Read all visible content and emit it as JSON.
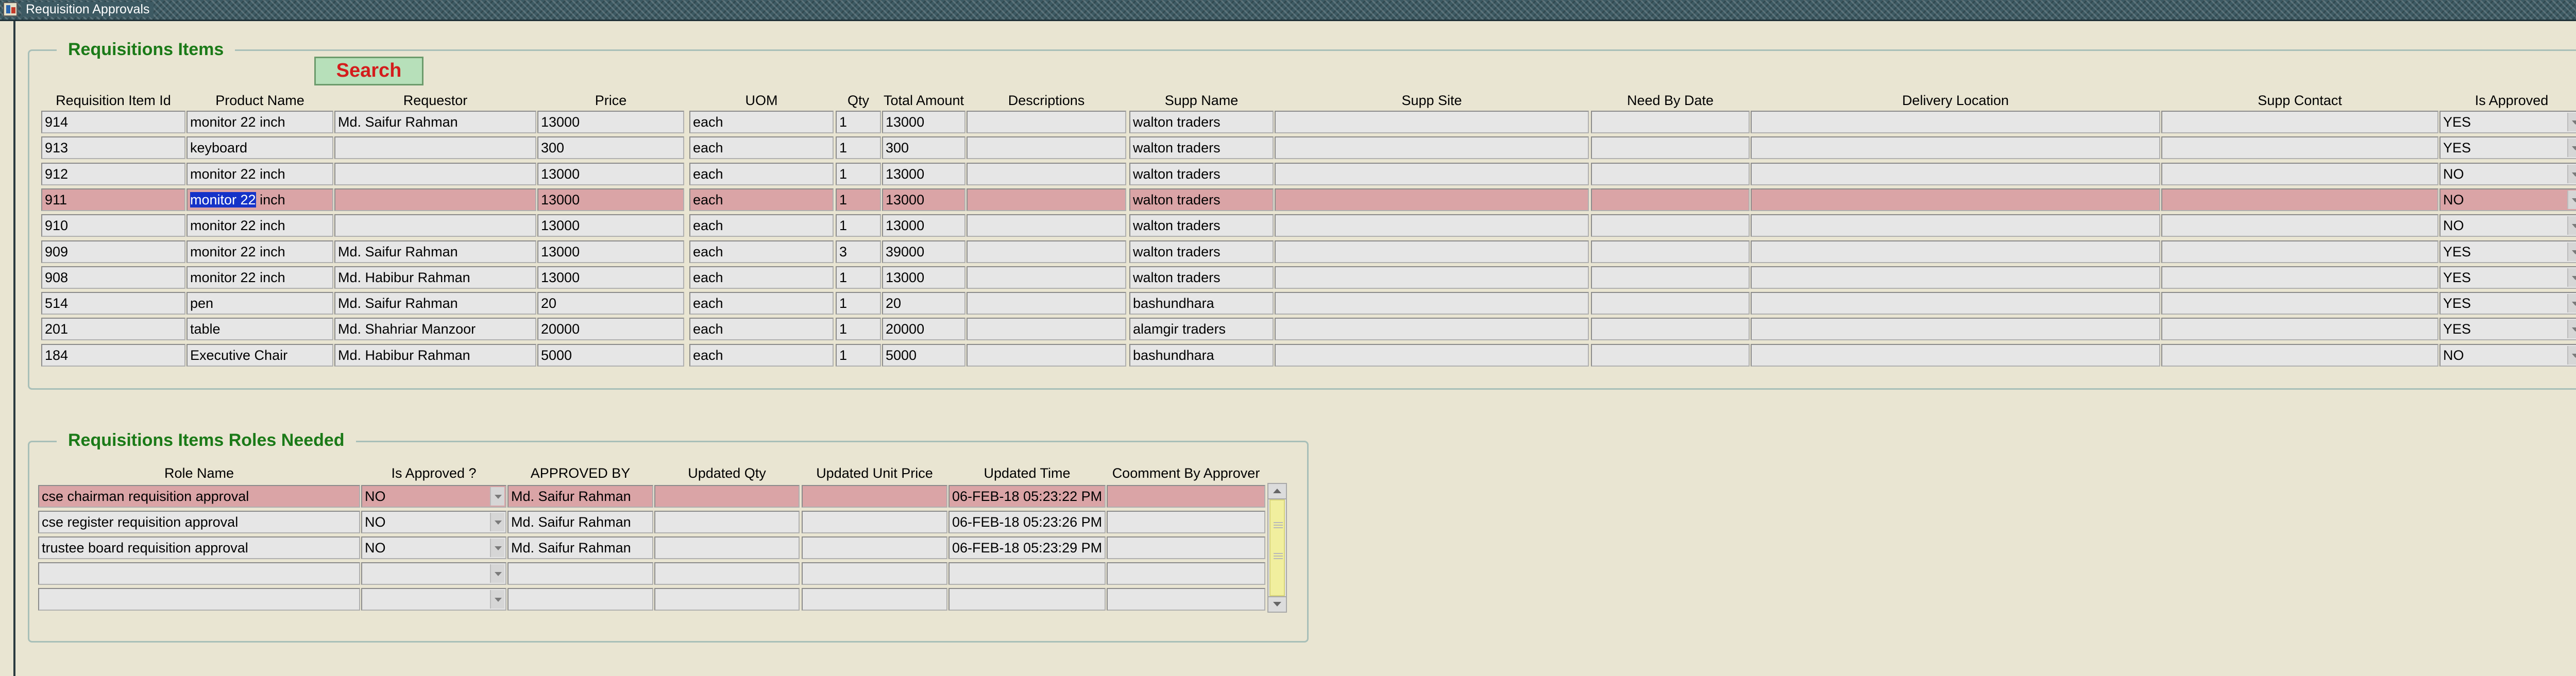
{
  "window": {
    "title": "Requisition Approvals",
    "icon": "app-window-icon"
  },
  "requisitions": {
    "title": "Requisitions Items",
    "search_label": "Search",
    "columns": {
      "id": "Requisition Item Id",
      "product": "Product Name",
      "requestor": "Requestor",
      "price": "Price",
      "uom": "UOM",
      "qty": "Qty",
      "total": "Total Amount",
      "descriptions": "Descriptions",
      "supp_name": "Supp Name",
      "supp_site": "Supp Site",
      "need_by": "Need By Date",
      "delivery": "Delivery Location",
      "supp_contact": "Supp Contact",
      "approved": "Is Approved"
    },
    "selected_row_index": 3,
    "selected_text_fragment": "monitor 22",
    "rows": [
      {
        "id": "914",
        "product": "monitor 22 inch",
        "requestor": "Md. Saifur Rahman",
        "price": "13000",
        "uom": "each",
        "qty": "1",
        "total": "13000",
        "descriptions": "",
        "supp_name": "walton traders",
        "supp_site": "",
        "need_by": "",
        "delivery": "",
        "supp_contact": "",
        "approved": "YES"
      },
      {
        "id": "913",
        "product": "keyboard",
        "requestor": "",
        "price": "300",
        "uom": "each",
        "qty": "1",
        "total": "300",
        "descriptions": "",
        "supp_name": "walton traders",
        "supp_site": "",
        "need_by": "",
        "delivery": "",
        "supp_contact": "",
        "approved": "YES"
      },
      {
        "id": "912",
        "product": "monitor 22 inch",
        "requestor": "",
        "price": "13000",
        "uom": "each",
        "qty": "1",
        "total": "13000",
        "descriptions": "",
        "supp_name": "walton traders",
        "supp_site": "",
        "need_by": "",
        "delivery": "",
        "supp_contact": "",
        "approved": "NO"
      },
      {
        "id": "911",
        "product": "monitor 22 inch",
        "requestor": "",
        "price": "13000",
        "uom": "each",
        "qty": "1",
        "total": "13000",
        "descriptions": "",
        "supp_name": "walton traders",
        "supp_site": "",
        "need_by": "",
        "delivery": "",
        "supp_contact": "",
        "approved": "NO"
      },
      {
        "id": "910",
        "product": "monitor 22 inch",
        "requestor": "",
        "price": "13000",
        "uom": "each",
        "qty": "1",
        "total": "13000",
        "descriptions": "",
        "supp_name": "walton traders",
        "supp_site": "",
        "need_by": "",
        "delivery": "",
        "supp_contact": "",
        "approved": "NO"
      },
      {
        "id": "909",
        "product": "monitor 22 inch",
        "requestor": "Md. Saifur Rahman",
        "price": "13000",
        "uom": "each",
        "qty": "3",
        "total": "39000",
        "descriptions": "",
        "supp_name": "walton traders",
        "supp_site": "",
        "need_by": "",
        "delivery": "",
        "supp_contact": "",
        "approved": "YES"
      },
      {
        "id": "908",
        "product": "monitor 22 inch",
        "requestor": "Md. Habibur Rahman",
        "price": "13000",
        "uom": "each",
        "qty": "1",
        "total": "13000",
        "descriptions": "",
        "supp_name": "walton traders",
        "supp_site": "",
        "need_by": "",
        "delivery": "",
        "supp_contact": "",
        "approved": "YES"
      },
      {
        "id": "514",
        "product": "pen",
        "requestor": "Md. Saifur Rahman",
        "price": "20",
        "uom": "each",
        "qty": "1",
        "total": "20",
        "descriptions": "",
        "supp_name": "bashundhara",
        "supp_site": "",
        "need_by": "",
        "delivery": "",
        "supp_contact": "",
        "approved": "YES"
      },
      {
        "id": "201",
        "product": "table",
        "requestor": "Md. Shahriar Manzoor",
        "price": "20000",
        "uom": "each",
        "qty": "1",
        "total": "20000",
        "descriptions": "",
        "supp_name": "alamgir traders",
        "supp_site": "",
        "need_by": "",
        "delivery": "",
        "supp_contact": "",
        "approved": "YES"
      },
      {
        "id": "184",
        "product": "Executive Chair",
        "requestor": "Md. Habibur Rahman",
        "price": "5000",
        "uom": "each",
        "qty": "1",
        "total": "5000",
        "descriptions": "",
        "supp_name": "bashundhara",
        "supp_site": "",
        "need_by": "",
        "delivery": "",
        "supp_contact": "",
        "approved": "NO"
      }
    ]
  },
  "roles": {
    "title": "Requisitions Items Roles Needed",
    "columns": {
      "role": "Role Name",
      "approved": "Is Approved ?",
      "approved_by": "APPROVED BY",
      "upd_qty": "Updated Qty",
      "upd_price": "Updated Unit Price",
      "upd_time": "Updated Time",
      "comment": "Coomment By Approver"
    },
    "selected_row_index": 0,
    "rows": [
      {
        "role": "cse chairman requisition approval",
        "approved": "NO",
        "approved_by": "Md. Saifur Rahman",
        "upd_qty": "",
        "upd_price": "",
        "upd_time": "06-FEB-18 05:23:22 PM",
        "comment": ""
      },
      {
        "role": "cse register requisition approval",
        "approved": "NO",
        "approved_by": "Md. Saifur Rahman",
        "upd_qty": "",
        "upd_price": "",
        "upd_time": "06-FEB-18 05:23:26 PM",
        "comment": ""
      },
      {
        "role": "trustee board requisition approval",
        "approved": "NO",
        "approved_by": "Md. Saifur Rahman",
        "upd_qty": "",
        "upd_price": "",
        "upd_time": "06-FEB-18 05:23:29 PM",
        "comment": ""
      },
      {
        "role": "",
        "approved": "",
        "approved_by": "",
        "upd_qty": "",
        "upd_price": "",
        "upd_time": "",
        "comment": ""
      },
      {
        "role": "",
        "approved": "",
        "approved_by": "",
        "upd_qty": "",
        "upd_price": "",
        "upd_time": "",
        "comment": ""
      }
    ]
  },
  "colors": {
    "background": "#e9e5d2",
    "title_green": "#1b7a18",
    "search_red": "#d41c1c",
    "selected_row": "#daa4a6",
    "text_highlight": "#1532c8"
  }
}
